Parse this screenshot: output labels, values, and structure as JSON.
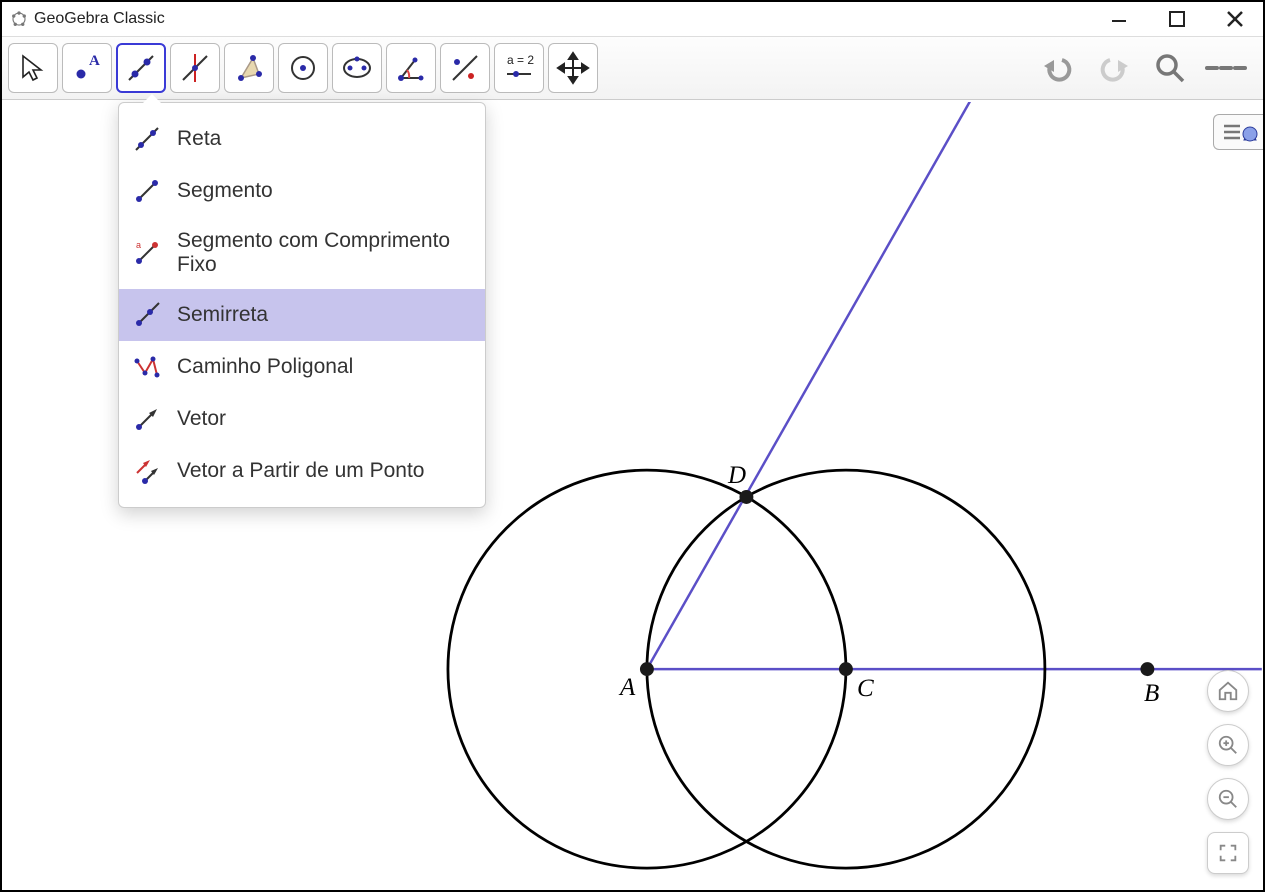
{
  "app": {
    "title": "GeoGebra Classic"
  },
  "toolbar": {
    "tools": [
      {
        "name": "move-tool"
      },
      {
        "name": "point-tool"
      },
      {
        "name": "line-tool",
        "selected": true
      },
      {
        "name": "perpendicular-tool"
      },
      {
        "name": "polygon-tool"
      },
      {
        "name": "circle-tool"
      },
      {
        "name": "ellipse-tool"
      },
      {
        "name": "angle-tool"
      },
      {
        "name": "reflect-tool"
      },
      {
        "name": "slider-tool",
        "label": "a = 2"
      },
      {
        "name": "move-view-tool"
      }
    ]
  },
  "dropdown": {
    "items": [
      {
        "name": "line",
        "label": "Reta"
      },
      {
        "name": "segment",
        "label": "Segmento"
      },
      {
        "name": "segment-fixed",
        "label": "Segmento com Comprimento Fixo"
      },
      {
        "name": "ray",
        "label": "Semirreta",
        "highlight": true
      },
      {
        "name": "polyline",
        "label": "Caminho Poligonal"
      },
      {
        "name": "vector",
        "label": "Vetor"
      },
      {
        "name": "vector-from-point",
        "label": "Vetor a Partir de um Ponto"
      }
    ]
  },
  "points": {
    "A": "A",
    "B": "B",
    "C": "C",
    "D": "D"
  },
  "colors": {
    "accent": "#5b4fc7",
    "point": "#1a1a1a"
  }
}
